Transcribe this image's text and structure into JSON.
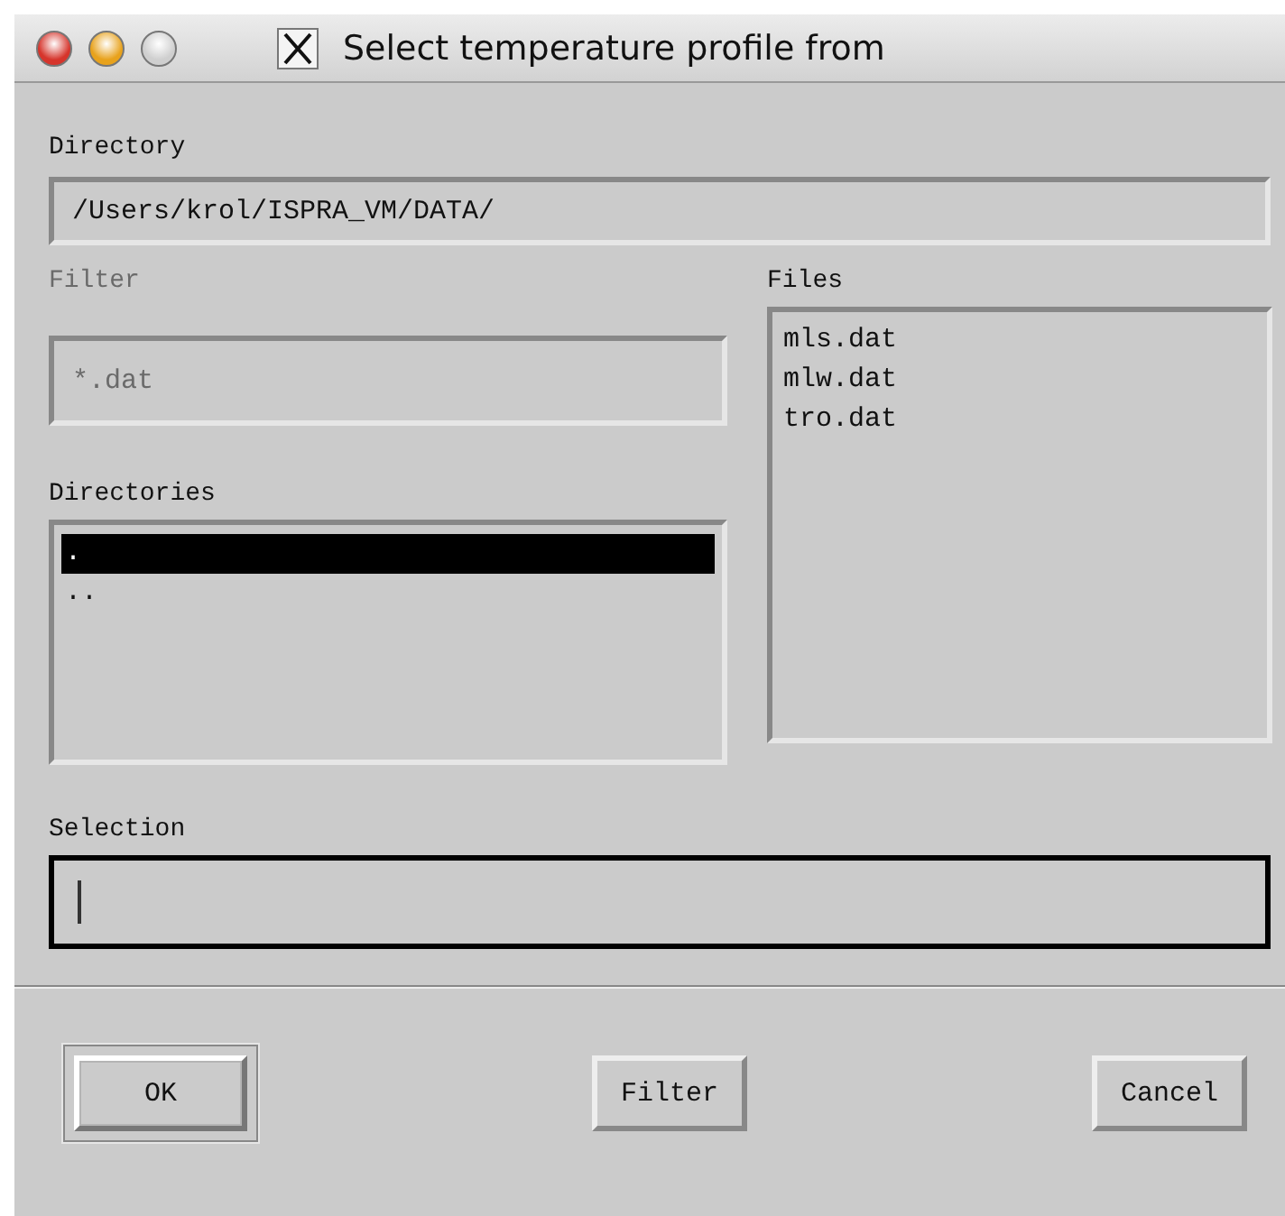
{
  "window": {
    "title": "Select temperature profile from",
    "zoom_enabled": false
  },
  "directory": {
    "label": "Directory",
    "value": "/Users/krol/ISPRA_VM/DATA/"
  },
  "filter": {
    "label": "Filter",
    "value": "*.dat",
    "disabled": true
  },
  "files": {
    "label": "Files",
    "items": [
      {
        "name": "mls.dat",
        "selected": false
      },
      {
        "name": "mlw.dat",
        "selected": false
      },
      {
        "name": "tro.dat",
        "selected": false
      }
    ]
  },
  "directories": {
    "label": "Directories",
    "items": [
      {
        "name": ".",
        "selected": true
      },
      {
        "name": "..",
        "selected": false
      }
    ]
  },
  "selection": {
    "label": "Selection",
    "focused": true
  },
  "buttons": [
    {
      "label": "OK",
      "default": true
    },
    {
      "label": "Filter",
      "default": false
    },
    {
      "label": "Cancel",
      "default": false
    }
  ]
}
